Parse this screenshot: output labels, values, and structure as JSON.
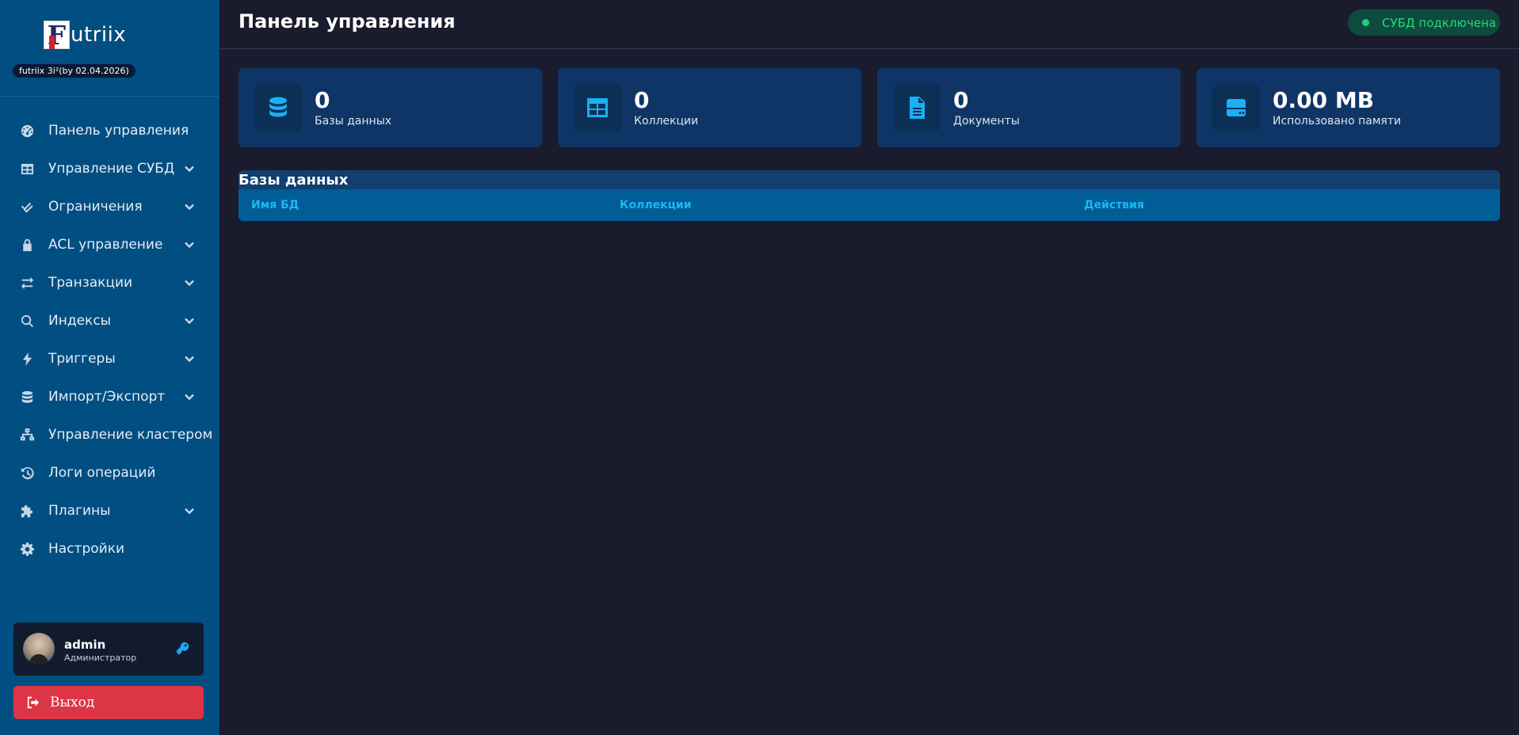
{
  "brand": {
    "logo_letter": "F",
    "logo_text": "utriix",
    "version": "futriix 3i²(by 02.04.2026)"
  },
  "sidebar": {
    "items": [
      {
        "label": "Панель управления",
        "icon": "dashboard-icon",
        "expandable": false
      },
      {
        "label": "Управление СУБД",
        "icon": "table-icon",
        "expandable": true
      },
      {
        "label": "Ограничения",
        "icon": "check-double-icon",
        "expandable": true
      },
      {
        "label": "ACL управление",
        "icon": "lock-icon",
        "expandable": true
      },
      {
        "label": "Транзакции",
        "icon": "exchange-icon",
        "expandable": true
      },
      {
        "label": "Индексы",
        "icon": "search-icon",
        "expandable": true
      },
      {
        "label": "Триггеры",
        "icon": "bolt-icon",
        "expandable": true
      },
      {
        "label": "Импорт/Экспорт",
        "icon": "database-icon",
        "expandable": true
      },
      {
        "label": "Управление кластером",
        "icon": "sitemap-icon",
        "expandable": false
      },
      {
        "label": "Логи операций",
        "icon": "history-icon",
        "expandable": false
      },
      {
        "label": "Плагины",
        "icon": "puzzle-icon",
        "expandable": true
      },
      {
        "label": "Настройки",
        "icon": "gear-icon",
        "expandable": false
      }
    ]
  },
  "user": {
    "name": "admin",
    "role": "Администратор"
  },
  "logout": {
    "label": "Выход"
  },
  "header": {
    "title": "Панель управления",
    "status": "СУБД подключена"
  },
  "colors": {
    "sidebar_bg": "#004e82",
    "main_bg": "#1b1b2e",
    "accent": "#1ab0f5",
    "status_green": "#24d97f",
    "danger": "#dc3545"
  },
  "stats": [
    {
      "value": "0",
      "label": "Базы данных",
      "icon": "database-icon"
    },
    {
      "value": "0",
      "label": "Коллекции",
      "icon": "table-icon"
    },
    {
      "value": "0",
      "label": "Документы",
      "icon": "file-icon"
    },
    {
      "value": "0.00 MB",
      "label": "Использовано памяти",
      "icon": "hdd-icon"
    }
  ],
  "databases": {
    "title": "Базы данных",
    "columns": [
      "Имя БД",
      "Коллекции",
      "Действия"
    ]
  }
}
